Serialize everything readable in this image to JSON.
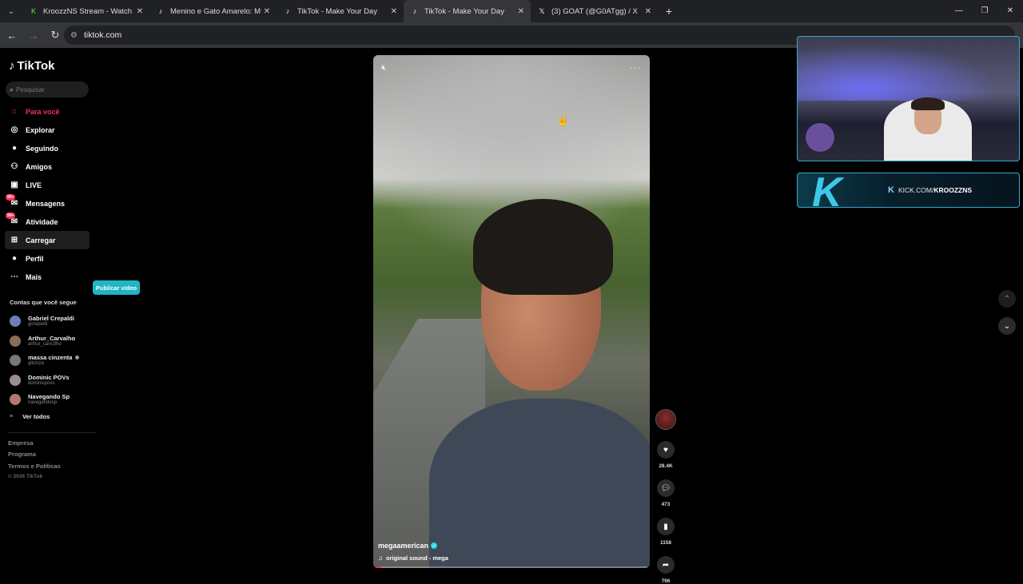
{
  "browser": {
    "tabs": [
      {
        "title": "KroozzNS Stream - Watch Live o",
        "icon": "kick-icon",
        "color": "#53fc18"
      },
      {
        "title": "Menino e Gato Amarelo: Mome",
        "icon": "tiktok-icon",
        "color": "#ffffff"
      },
      {
        "title": "TikTok - Make Your Day",
        "icon": "tiktok-icon",
        "color": "#ffffff"
      },
      {
        "title": "TikTok - Make Your Day",
        "icon": "tiktok-icon",
        "color": "#ffffff"
      },
      {
        "title": "(3) GOAT (@G0ATgg) / X",
        "icon": "x-icon",
        "color": "#ffffff"
      }
    ],
    "active_tab": 3,
    "url": "tiktok.com"
  },
  "sidebar": {
    "logo": "TikTok",
    "search_placeholder": "Pesquisar",
    "nav": [
      {
        "label": "Para você",
        "icon": "home-icon"
      },
      {
        "label": "Explorar",
        "icon": "compass-icon"
      },
      {
        "label": "Seguindo",
        "icon": "following-icon"
      },
      {
        "label": "Amigos",
        "icon": "friends-icon"
      },
      {
        "label": "LIVE",
        "icon": "live-icon"
      },
      {
        "label": "Mensagens",
        "icon": "messages-icon",
        "badge": "99+"
      },
      {
        "label": "Atividade",
        "icon": "activity-icon",
        "badge": "99+"
      },
      {
        "label": "Carregar",
        "icon": "upload-icon"
      },
      {
        "label": "Perfil",
        "icon": "profile-icon"
      },
      {
        "label": "Mais",
        "icon": "more-icon"
      }
    ],
    "publish_button": "Publicar vídeo",
    "following_title": "Contas que você segue",
    "following": [
      {
        "name": "Gabriel Crepaldi",
        "handle": "gcrepaldi"
      },
      {
        "name": "Arthur_Carvalho",
        "handle": "arthur_carv2lho"
      },
      {
        "name": "massa cinzenta",
        "handle": "glicinza"
      },
      {
        "name": "Dominic POVs",
        "handle": "dominicpovs"
      },
      {
        "name": "Navegando Sp",
        "handle": "navegandosp"
      }
    ],
    "see_all": "Ver todos",
    "footer": [
      "Empresa",
      "Programa",
      "Termos e Políticas"
    ],
    "copyright": "© 2026 TikTok"
  },
  "video": {
    "username": "megaamerican",
    "sound": "original sound - mega",
    "progress": 0.03
  },
  "actions": {
    "likes": "28.4K",
    "comments": "473",
    "saves": "1158",
    "shares": "796"
  },
  "overlay": {
    "kick_text_prefix": "KICK.COM/",
    "kick_text_name": "KROOZZNS"
  }
}
